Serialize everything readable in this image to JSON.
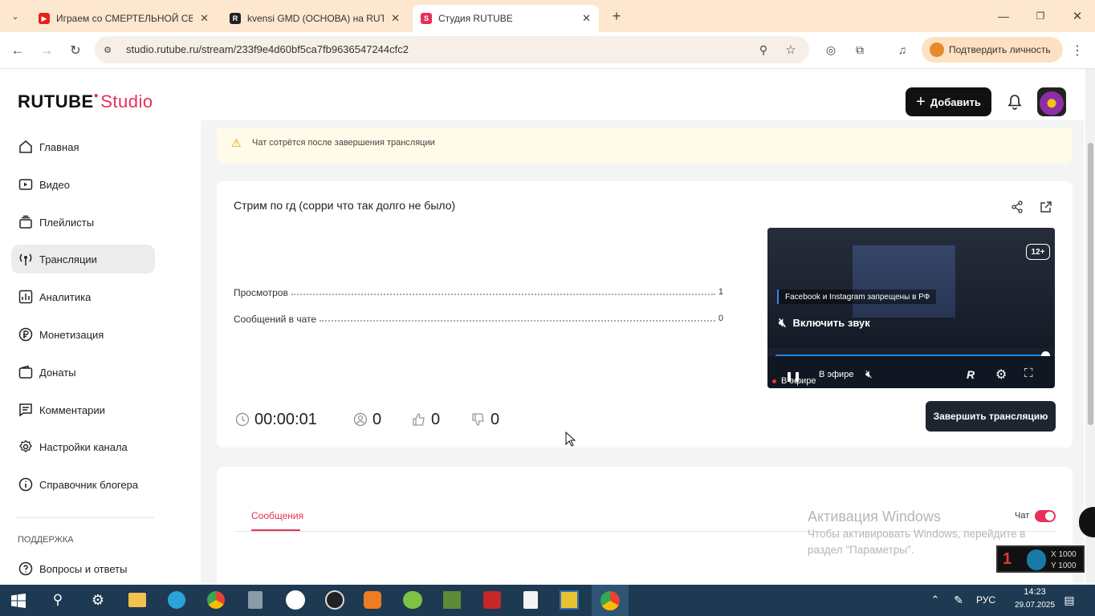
{
  "browser": {
    "tabs": [
      {
        "title": "Играем со СМЕРТЕЛЬНОЙ СВЕ…",
        "active": false
      },
      {
        "title": "kvensi GMD (ОСНОВА) на RUTU…",
        "active": false
      },
      {
        "title": "Студия RUTUBE",
        "active": true
      }
    ],
    "url": "studio.rutube.ru/stream/233f9e4d60bf5ca7fb9636547244cfc2",
    "verify_label": "Подтвердить личность"
  },
  "app": {
    "logo_main": "RUTUBE",
    "logo_sub": "Studio",
    "add_button": "Добавить",
    "nav": [
      {
        "label": "Главная",
        "icon": "home-icon"
      },
      {
        "label": "Видео",
        "icon": "video-icon"
      },
      {
        "label": "Плейлисты",
        "icon": "playlist-icon"
      },
      {
        "label": "Трансляции",
        "icon": "broadcast-icon",
        "active": true
      },
      {
        "label": "Аналитика",
        "icon": "analytics-icon"
      },
      {
        "label": "Монетизация",
        "icon": "ruble-icon"
      },
      {
        "label": "Донаты",
        "icon": "wallet-icon"
      },
      {
        "label": "Комментарии",
        "icon": "comments-icon"
      },
      {
        "label": "Настройки канала",
        "icon": "gear-icon"
      },
      {
        "label": "Справочник блогера",
        "icon": "info-icon"
      }
    ],
    "support_heading": "ПОДДЕРЖКА",
    "support_items": [
      {
        "label": "Вопросы и ответы",
        "icon": "question-icon"
      }
    ]
  },
  "stream": {
    "warning": "Чат сотрётся после завершения трансляции",
    "title": "Стрим по гд (сорри что так долго не было)",
    "stats": [
      {
        "label": "Просмотров",
        "value": "1"
      },
      {
        "label": "Сообщений в чате",
        "value": "0"
      }
    ],
    "duration": "00:00:01",
    "viewers": "0",
    "likes": "0",
    "dislikes": "0",
    "end_button": "Завершить трансляцию",
    "player": {
      "age": "12+",
      "banner": "Facebook и Instagram запрещены в РФ",
      "unmute": "Включить звук",
      "live_label": "В эфире",
      "live_label_under": "В эфире",
      "progress": 1.0
    }
  },
  "chat": {
    "tab": "Сообщения",
    "toggle_label": "Чат",
    "toggle_on": true
  },
  "windows_overlay": {
    "line1": "Активация Windows",
    "line2": "Чтобы активировать Windows, перейдите в",
    "line3": "раздел \"Параметры\"."
  },
  "mouse_overlay": {
    "x_label": "X 1000",
    "y_label": "Y 1000"
  },
  "taskbar": {
    "lang": "РУС",
    "time": "14:23",
    "date": "29.07.2025"
  }
}
